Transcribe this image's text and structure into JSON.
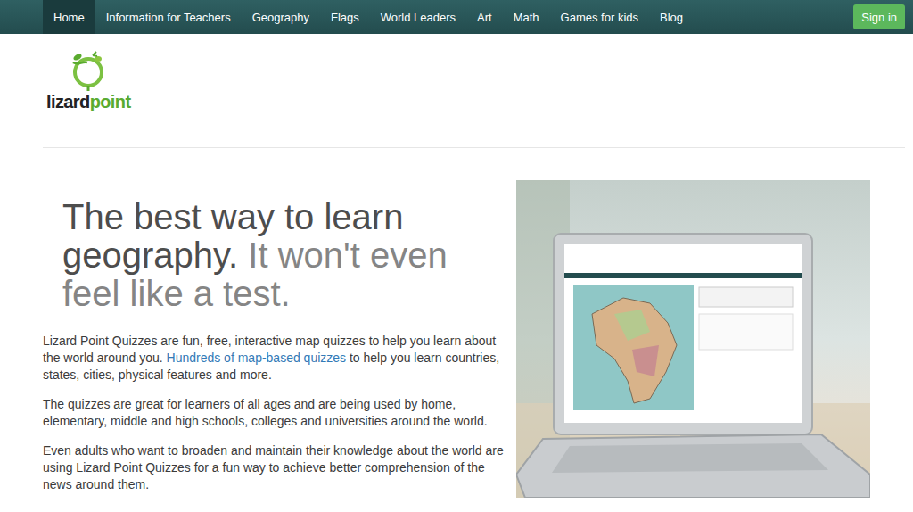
{
  "nav": {
    "items": [
      {
        "label": "Home",
        "selected": true
      },
      {
        "label": "Information for Teachers",
        "selected": false
      },
      {
        "label": "Geography",
        "selected": false
      },
      {
        "label": "Flags",
        "selected": false
      },
      {
        "label": "World Leaders",
        "selected": false
      },
      {
        "label": "Art",
        "selected": false
      },
      {
        "label": "Math",
        "selected": false
      },
      {
        "label": "Games for kids",
        "selected": false
      },
      {
        "label": "Blog",
        "selected": false
      }
    ],
    "sign_in": "Sign in"
  },
  "logo": {
    "dark": "lizard",
    "green": "point"
  },
  "hero": {
    "heading": [
      {
        "text": "The best way to learn geography.",
        "light": false
      },
      {
        "text": "It won't even feel like a test.",
        "light": true
      }
    ],
    "paragraphs": [
      [
        {
          "text": "Lizard Point Quizzes are fun, free, interactive map quizzes to help you learn about the world around you. ",
          "link": false
        },
        {
          "text": "Hundreds of map-based quizzes",
          "link": true
        },
        {
          "text": " to help you learn countries, states, cities, physical features and more.",
          "link": false
        }
      ],
      [
        {
          "text": "The quizzes are great for learners of all ages and are being used by home, elementary, middle and high schools, colleges and universities around the world.",
          "link": false
        }
      ],
      [
        {
          "text": "Even adults who want to broaden and maintain their knowledge about the world are using Lizard Point Quizzes for a fun way to achieve better comprehension of the news around them.",
          "link": false
        }
      ]
    ]
  }
}
